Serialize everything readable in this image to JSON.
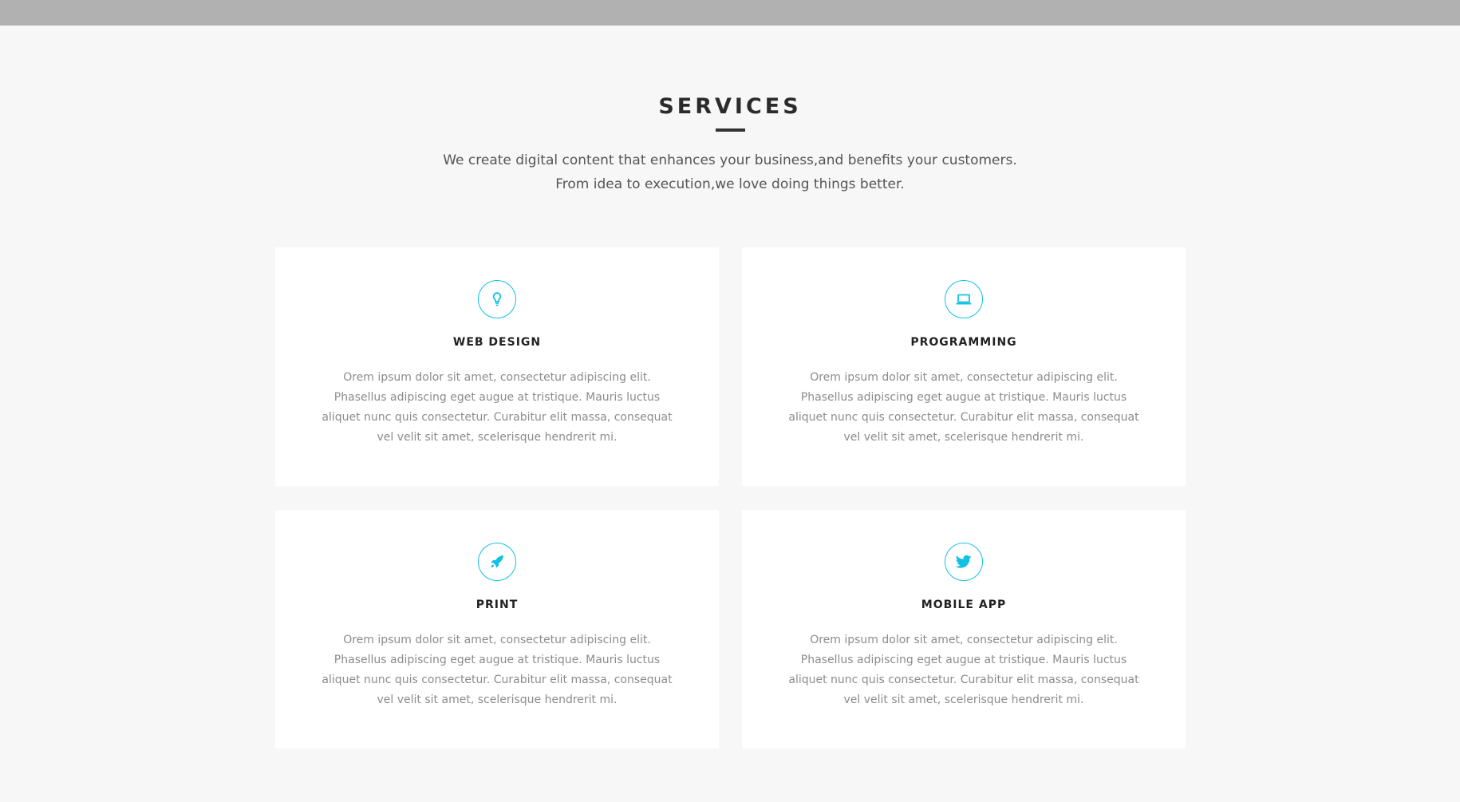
{
  "section": {
    "title": "SERVICES",
    "subtitle": "We create digital content that enhances your business,and benefits your customers. From idea to execution,we love doing things better."
  },
  "services": [
    {
      "icon": "lightbulb-icon",
      "title": "WEB DESIGN",
      "text": "Orem ipsum dolor sit amet, consectetur adipiscing elit. Phasellus adipiscing eget augue at tristique. Mauris luctus aliquet nunc quis consectetur. Curabitur elit massa, consequat vel velit sit amet, scelerisque hendrerit mi."
    },
    {
      "icon": "laptop-icon",
      "title": "PROGRAMMING",
      "text": "Orem ipsum dolor sit amet, consectetur adipiscing elit. Phasellus adipiscing eget augue at tristique. Mauris luctus aliquet nunc quis consectetur. Curabitur elit massa, consequat vel velit sit amet, scelerisque hendrerit mi."
    },
    {
      "icon": "rocket-icon",
      "title": "PRINT",
      "text": "Orem ipsum dolor sit amet, consectetur adipiscing elit. Phasellus adipiscing eget augue at tristique. Mauris luctus aliquet nunc quis consectetur. Curabitur elit massa, consequat vel velit sit amet, scelerisque hendrerit mi."
    },
    {
      "icon": "twitter-icon",
      "title": "MOBILE APP",
      "text": "Orem ipsum dolor sit amet, consectetur adipiscing elit. Phasellus adipiscing eget augue at tristique. Mauris luctus aliquet nunc quis consectetur. Curabitur elit massa, consequat vel velit sit amet, scelerisque hendrerit mi."
    }
  ],
  "colors": {
    "accent": "#12c1e3",
    "background": "#f7f7f7",
    "card": "#ffffff",
    "topbar": "#b1b1b1",
    "heading": "#2b2b2b",
    "body_text": "#8c8c8c"
  }
}
